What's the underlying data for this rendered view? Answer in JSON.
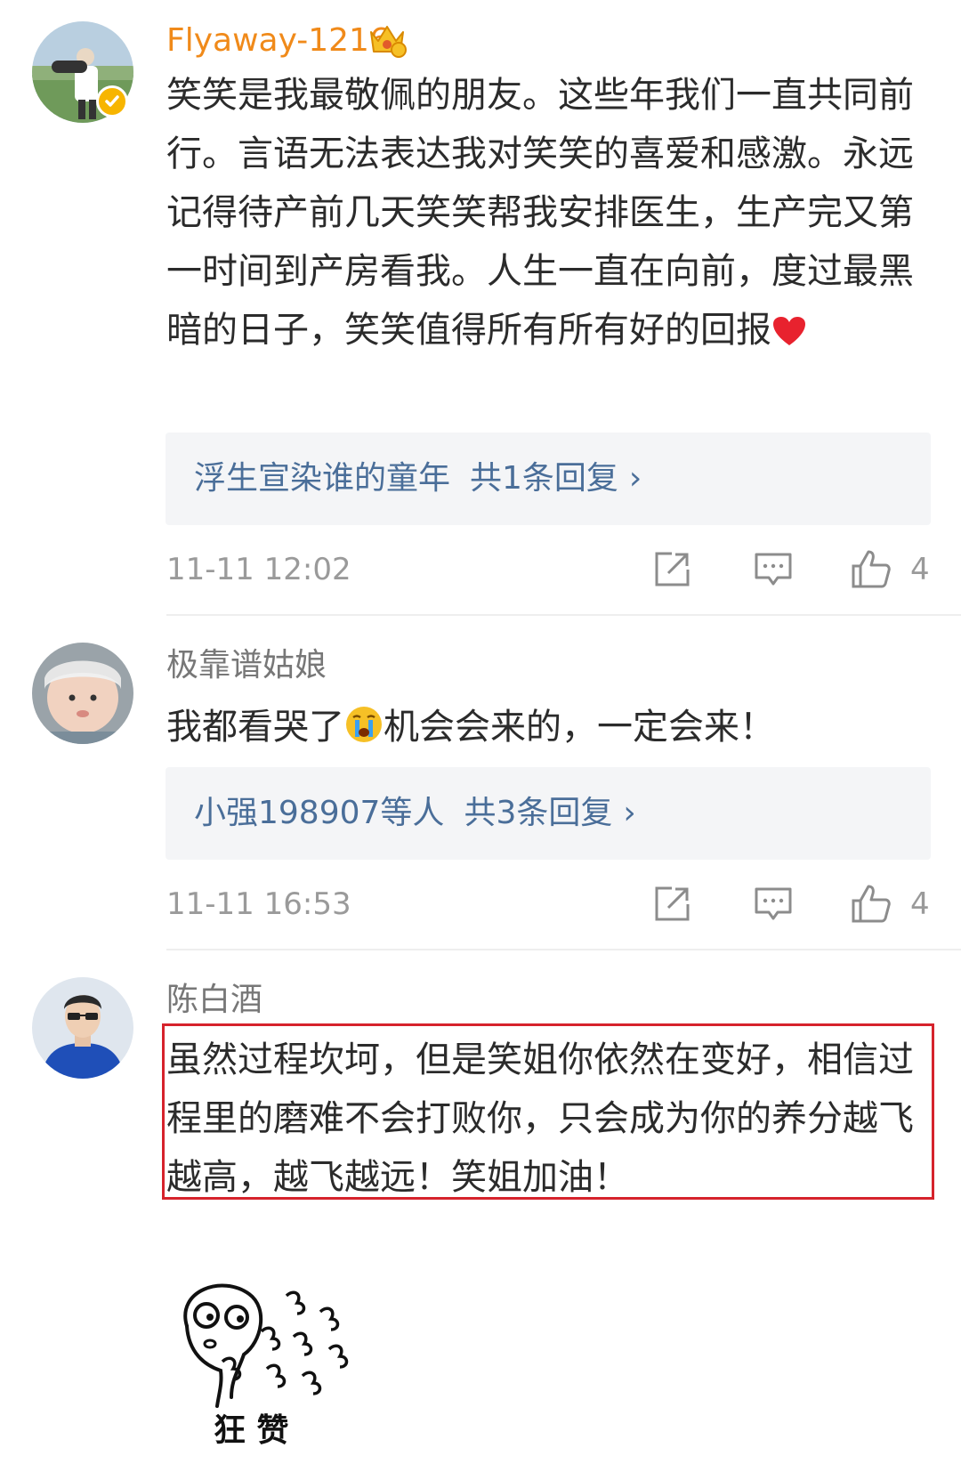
{
  "comments": [
    {
      "username": "Flyaway-1216",
      "text": "笑笑是我最敬佩的朋友。这些年我们一直共同前行。言语无法表达我对笑笑的喜爱和感激。永远记得待产前几天笑笑帮我安排医生，生产完又第一时间到产房看我。人生一直在向前，度过最黑暗的日子，笑笑值得所有所有好的回报",
      "emoji": "heart-emoji",
      "reply_link": {
        "names": "浮生宣染谁的童年",
        "count_text": "共1条回复",
        "arrow": "›"
      },
      "timestamp": "11-11 12:02",
      "likes": "4"
    },
    {
      "username": "极靠谱姑娘",
      "text_before": "我都看哭了",
      "emoji": "crying-face-emoji",
      "text_after": "机会会来的，一定会来！",
      "reply_link": {
        "names": "小强198907等人",
        "count_text": "共3条回复",
        "arrow": "›"
      },
      "timestamp": "11-11 16:53",
      "likes": "4"
    },
    {
      "username": "陈白酒",
      "text": "虽然过程坎坷，但是笑姐你依然在变好，相信过程里的磨难不会打败你，只会成为你的养分越飞越高，越飞越远！笑姐加油！",
      "sticker_text": "狂 赞"
    }
  ],
  "colors": {
    "username_vip": "#f08a1a",
    "reply_link": "#4a6e99",
    "highlight_border": "#d6232c",
    "verified_badge": "#f7b500"
  },
  "icons": [
    "verified-badge-icon",
    "crown-level-icon",
    "share-icon",
    "comment-icon",
    "like-icon"
  ]
}
